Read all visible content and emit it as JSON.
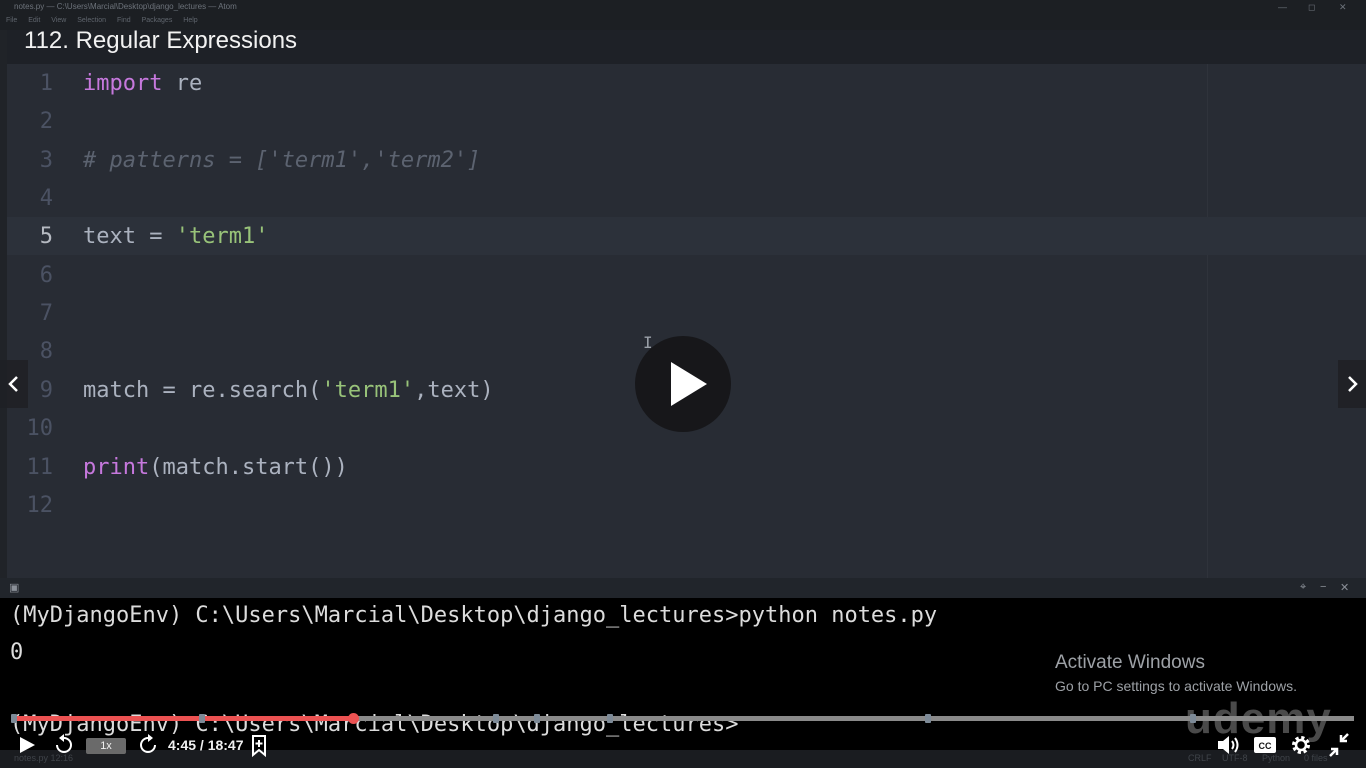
{
  "window": {
    "title": "notes.py — C:\\Users\\Marcial\\Desktop\\django_lectures — Atom",
    "menu": [
      "File",
      "Edit",
      "View",
      "Selection",
      "Find",
      "Packages",
      "Help"
    ]
  },
  "lecture_title": "112. Regular Expressions",
  "editor": {
    "line_numbers": [
      "1",
      "2",
      "3",
      "4",
      "5",
      "6",
      "7",
      "8",
      "9",
      "10",
      "11",
      "12"
    ],
    "active_line": 5,
    "lines": [
      {
        "kw": "import",
        "rest": " re"
      },
      {
        "comment": "# patterns = ['term1','term2']"
      },
      {
        "pre": "text = ",
        "sel": "'term1'"
      },
      {
        "pre": "match = re.search(",
        "str": "'term1'",
        "post": ",text)"
      },
      {
        "kw": "print",
        "rest": "(match.start())"
      }
    ]
  },
  "terminal": {
    "lines": [
      "(MyDjangoEnv) C:\\Users\\Marcial\\Desktop\\django_lectures>python notes.py",
      "0",
      "(MyDjangoEnv) C:\\Users\\Marcial\\Desktop\\django_lectures>"
    ]
  },
  "activation_notice": {
    "heading": "Activate Windows",
    "subtext": "Go to PC settings to activate Windows."
  },
  "watermark": "udemy",
  "statusbar": {
    "left": "notes.py  12:16",
    "right": [
      "CRLF",
      "UTF-8",
      "Python",
      "0 files"
    ]
  },
  "player": {
    "speed_label": "1x",
    "time": "4:45 / 18:47",
    "progress": 0.253,
    "marker_positions": [
      0.0,
      0.14,
      0.253,
      0.36,
      0.39,
      0.445,
      0.682,
      0.88
    ],
    "icons": {
      "play": "play-icon",
      "rewind": "rewind-5-icon",
      "forward": "forward-5-icon",
      "bookmark": "add-bookmark-icon",
      "volume": "volume-icon",
      "captions": "closed-captions-icon",
      "settings": "gear-icon",
      "fullscreen": "exit-fullscreen-icon"
    },
    "accent_color": "#ec5252"
  }
}
